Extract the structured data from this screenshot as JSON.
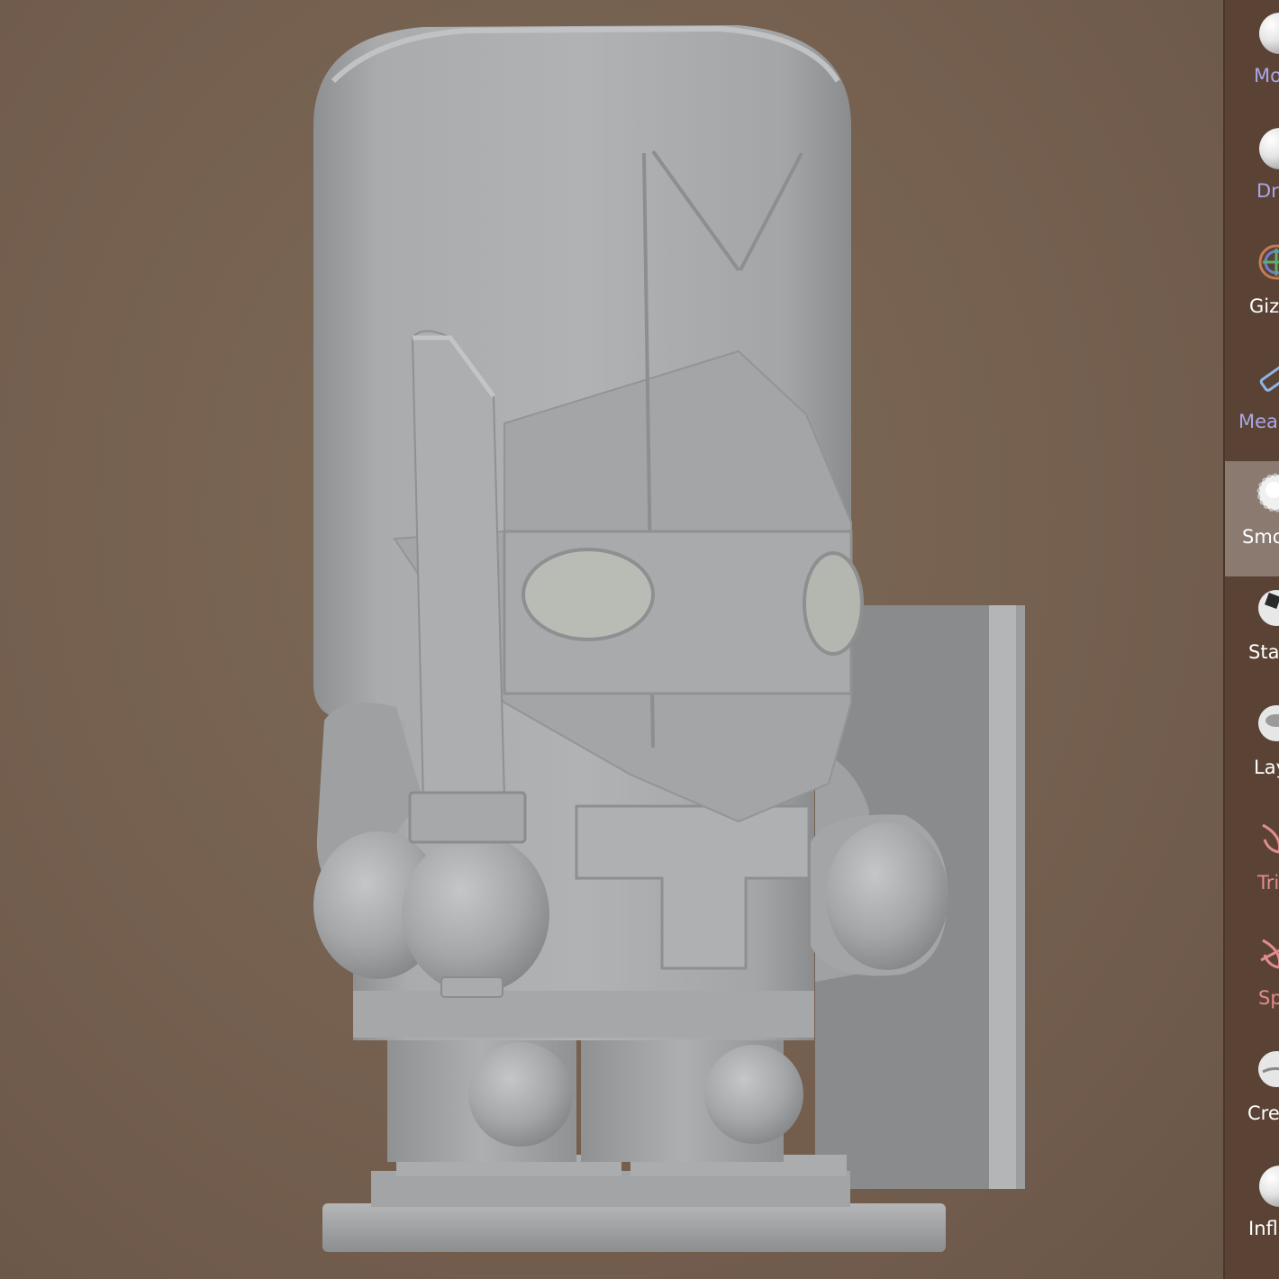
{
  "tools": [
    {
      "label": "Mo",
      "icon": "sphere-brush-icon",
      "color": "#a9a6e8",
      "active": false
    },
    {
      "label": "Dr",
      "icon": "sphere-brush-icon",
      "color": "#a9a6e8",
      "active": false
    },
    {
      "label": "Giz",
      "icon": "gizmo-icon",
      "color": "#ffffff",
      "active": false
    },
    {
      "label": "Mea",
      "icon": "ruler-icon",
      "color": "#a9a6e8",
      "active": false
    },
    {
      "label": "Smo",
      "icon": "smooth-brush-icon",
      "color": "#ffffff",
      "active": true
    },
    {
      "label": "Sta",
      "icon": "stamp-brush-icon",
      "color": "#ffffff",
      "active": false
    },
    {
      "label": "Lay",
      "icon": "layer-brush-icon",
      "color": "#ffffff",
      "active": false
    },
    {
      "label": "Tri",
      "icon": "trim-icon",
      "color": "#e08c8c",
      "active": false
    },
    {
      "label": "Sp",
      "icon": "split-icon",
      "color": "#e08c8c",
      "active": false
    },
    {
      "label": "Cre",
      "icon": "crease-brush-icon",
      "color": "#ffffff",
      "active": false
    },
    {
      "label": "Infl",
      "icon": "inflate-brush-icon",
      "color": "#ffffff",
      "active": false
    }
  ],
  "colors": {
    "background": "#7a6452",
    "panel": "#5a4335",
    "active_tool": "#8a7a70",
    "model": "#a7a9ab"
  }
}
